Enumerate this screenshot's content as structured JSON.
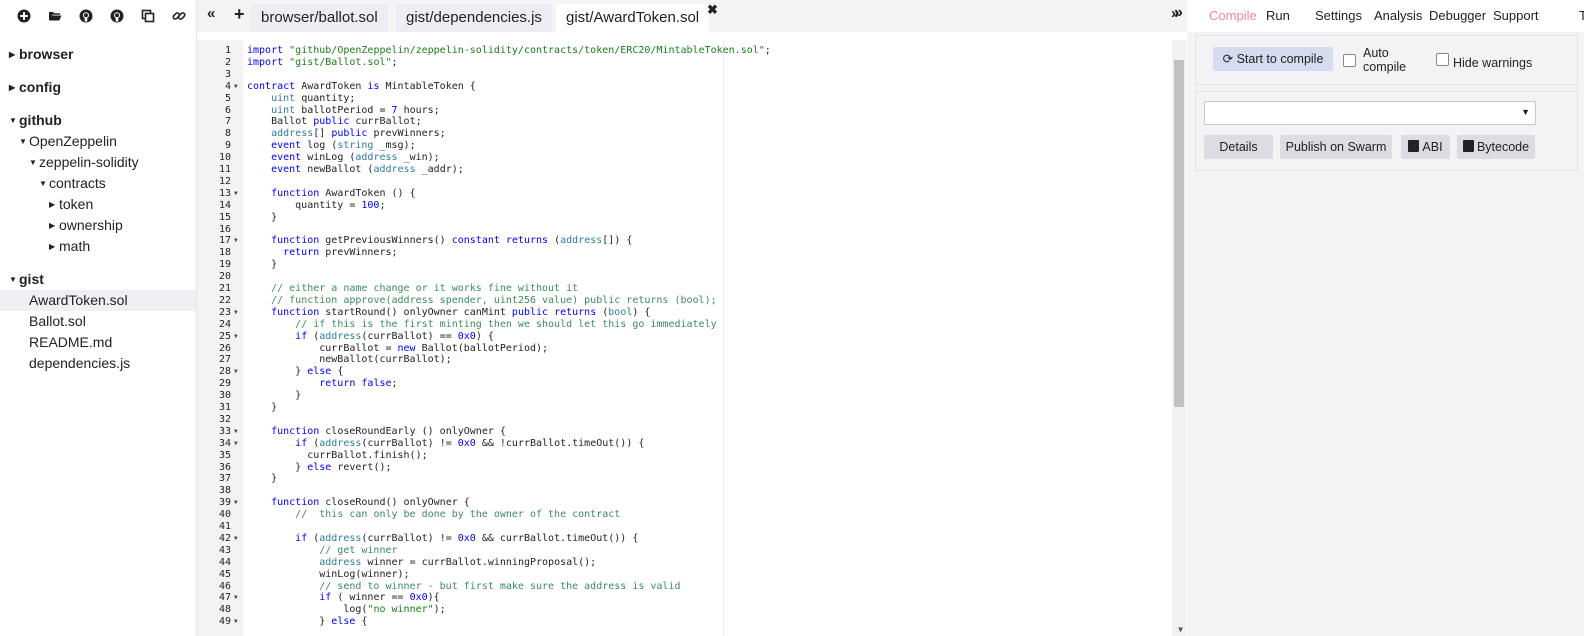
{
  "toolbar": {
    "icons": [
      "new-file-icon",
      "open-folder-icon",
      "github-icon",
      "github-publish-icon",
      "copy-icon",
      "link-icon"
    ]
  },
  "explorer": {
    "roots": [
      {
        "label": "browser",
        "expanded": false
      },
      {
        "label": "config",
        "expanded": false
      },
      {
        "label": "github",
        "expanded": true,
        "children": [
          {
            "label": "OpenZeppelin",
            "level": 1,
            "caret": "down"
          },
          {
            "label": "zeppelin-solidity",
            "level": 2,
            "caret": "down"
          },
          {
            "label": "contracts",
            "level": 3,
            "caret": "down"
          },
          {
            "label": "token",
            "level": 4,
            "caret": "right"
          },
          {
            "label": "ownership",
            "level": 4,
            "caret": "right"
          },
          {
            "label": "math",
            "level": 4,
            "caret": "right"
          }
        ]
      },
      {
        "label": "gist",
        "expanded": true,
        "children": [
          {
            "label": "AwardToken.sol",
            "level": 1,
            "selected": true
          },
          {
            "label": "Ballot.sol",
            "level": 1
          },
          {
            "label": "README.md",
            "level": 1
          },
          {
            "label": "dependencies.js",
            "level": 1
          }
        ]
      }
    ]
  },
  "tabs": {
    "collapse_left": "«",
    "add": "+",
    "files": [
      "browser/ballot.sol",
      "gist/dependencies.js",
      "gist/AwardToken.sol"
    ],
    "active_index": 2,
    "close": "✖",
    "expand_right": "»"
  },
  "editor": {
    "fold_lines": [
      4,
      13,
      17,
      23,
      25,
      28,
      33,
      34,
      39,
      42,
      47,
      49
    ],
    "lines": [
      "import \"github/OpenZeppelin/zeppelin-solidity/contracts/token/ERC20/MintableToken.sol\";",
      "import \"gist/Ballot.sol\";",
      "",
      "contract AwardToken is MintableToken {",
      "    uint quantity;",
      "    uint ballotPeriod = 7 hours;",
      "    Ballot public currBallot;",
      "    address[] public prevWinners;",
      "    event log (string _msg);",
      "    event winLog (address _win);",
      "    event newBallot (address _addr);",
      "",
      "    function AwardToken () {",
      "        quantity = 100;",
      "    }",
      "",
      "    function getPreviousWinners() constant returns (address[]) {",
      "      return prevWinners;",
      "    }",
      "",
      "    // either a name change or it works fine without it",
      "    // function approve(address spender, uint256 value) public returns (bool);",
      "    function startRound() onlyOwner canMint public returns (bool) {",
      "        // if this is the first minting then we should let this go immediately",
      "        if (address(currBallot) == 0x0) {",
      "            currBallot = new Ballot(ballotPeriod);",
      "            newBallot(currBallot);",
      "        } else {",
      "            return false;",
      "        }",
      "    }",
      "",
      "    function closeRoundEarly () onlyOwner {",
      "        if (address(currBallot) != 0x0 && !currBallot.timeOut()) {",
      "          currBallot.finish();",
      "        } else revert();",
      "    }",
      "",
      "    function closeRound() onlyOwner {",
      "        //  this can only be done by the owner of the contract",
      "",
      "        if (address(currBallot) != 0x0 && currBallot.timeOut()) {",
      "            // get winner",
      "            address winner = currBallot.winningProposal();",
      "            winLog(winner);",
      "            // send to winner - but first make sure the address is valid",
      "            if ( winner == 0x0){",
      "                log(\"no winner\");",
      "            } else {"
    ]
  },
  "right_tabs": {
    "collapse": "»",
    "items": [
      "Compile",
      "Run",
      "Settings",
      "Analysis",
      "Debugger",
      "Support",
      "T"
    ],
    "active_index": 0
  },
  "compile": {
    "start_label": "Start to compile",
    "auto_compile_label": "Auto\ncompile",
    "auto_compile_checked": false,
    "hide_warnings_label": "Hide warnings",
    "hide_warnings_checked": false,
    "contract_selected": "",
    "details_label": "Details",
    "publish_label": "Publish on Swarm",
    "abi_label": "ABI",
    "bytecode_label": "Bytecode"
  },
  "colors": {
    "accent": "#f58a95",
    "panel_bg": "#f3f3f5",
    "keyword": "#0000ff",
    "string": "#1a7f1a",
    "comment": "#3c8c5f"
  }
}
